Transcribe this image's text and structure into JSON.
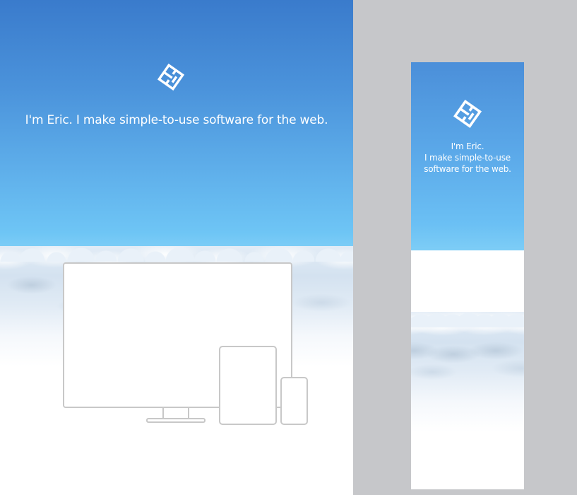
{
  "desktop": {
    "logo_icon": "ec-monogram-icon",
    "tagline": "I'm Eric. I make simple-to-use software for the web.",
    "devices": [
      "monitor-icon",
      "tablet-icon",
      "phone-icon"
    ]
  },
  "mobile": {
    "logo_icon": "ec-monogram-icon",
    "tagline_lines": [
      "I'm Eric.",
      "I make simple-to-use",
      "software for the web."
    ]
  },
  "colors": {
    "sky_top": "#3a7bcc",
    "sky_bottom": "#7dcdf6",
    "background_gray": "#c6c7ca",
    "device_outline": "#c8c8c8",
    "text": "#ffffff"
  }
}
